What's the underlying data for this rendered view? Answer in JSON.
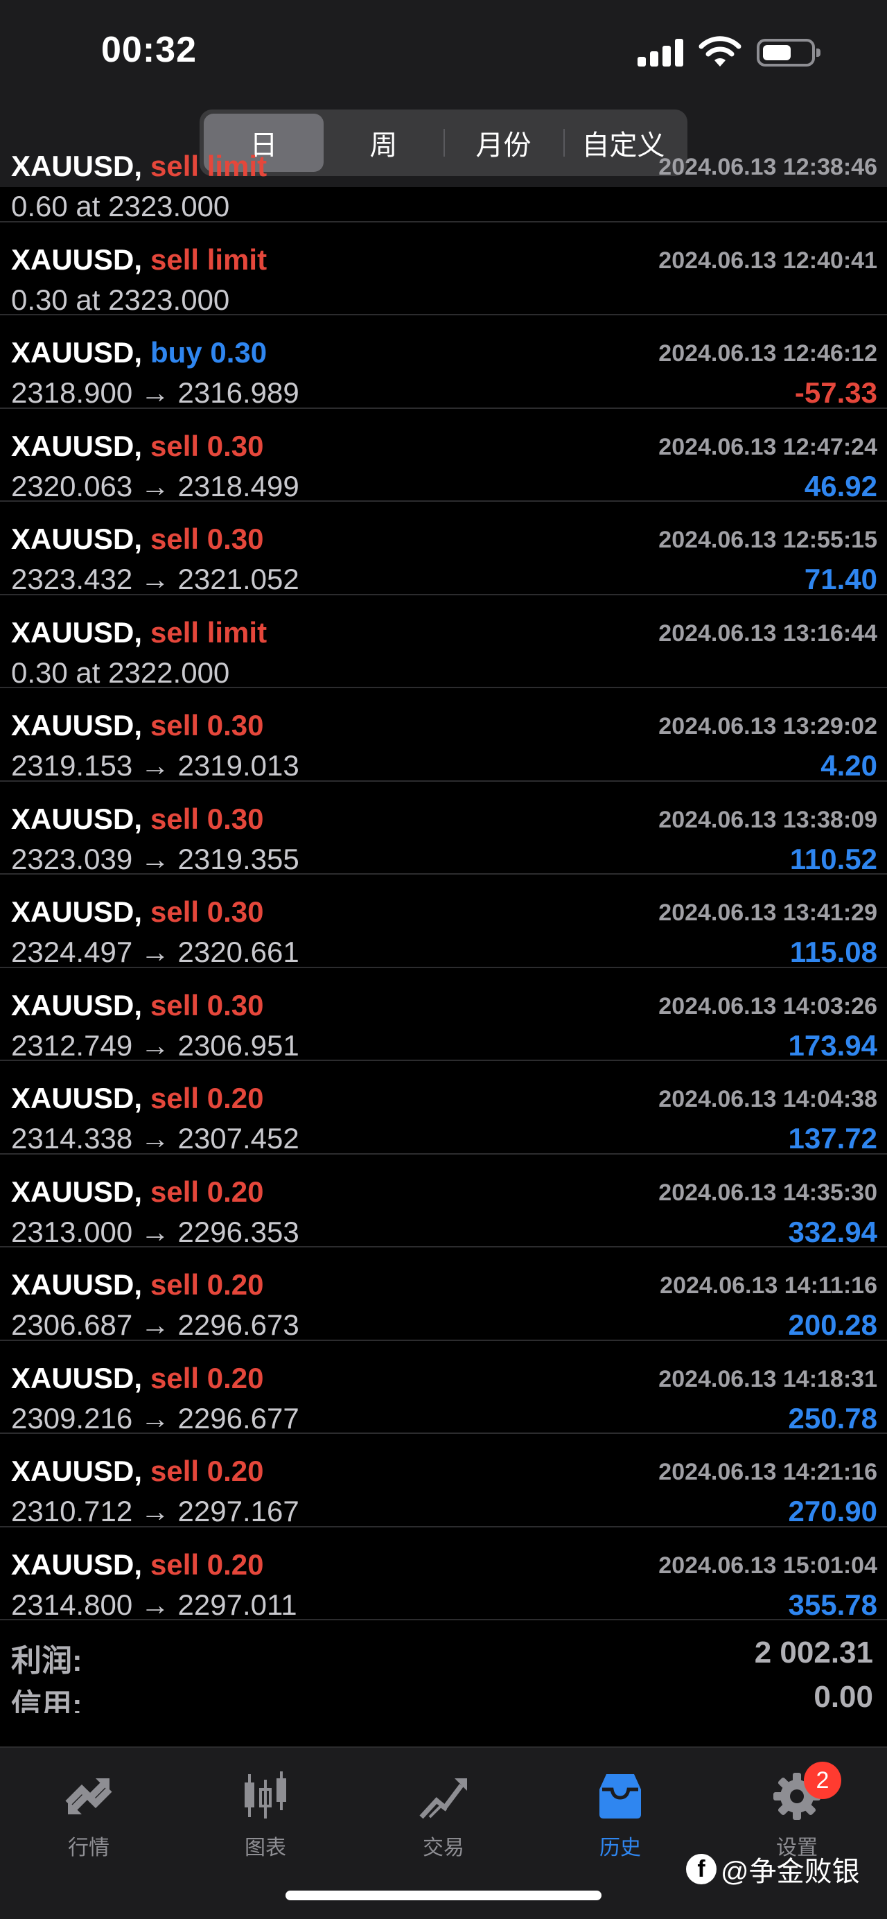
{
  "status_bar": {
    "time": "00:32"
  },
  "period_tabs": [
    {
      "label": "日",
      "active": true
    },
    {
      "label": "周",
      "active": false
    },
    {
      "label": "月份",
      "active": false
    },
    {
      "label": "自定义",
      "active": false
    }
  ],
  "orders": [
    {
      "symbol": "XAUUSD,",
      "type": "sell limit",
      "type_color": "red",
      "date": "2024.06.13 12:38:46",
      "detail": "0.60 at 2323.000",
      "profit": "",
      "profit_color": ""
    },
    {
      "symbol": "XAUUSD,",
      "type": "sell limit",
      "type_color": "red",
      "date": "2024.06.13 12:40:41",
      "detail": "0.30 at 2323.000",
      "profit": "",
      "profit_color": ""
    },
    {
      "symbol": "XAUUSD,",
      "type": "buy 0.30",
      "type_color": "blue",
      "date": "2024.06.13 12:46:12",
      "detail": "2318.900 → 2316.989",
      "profit": "-57.33",
      "profit_color": "red"
    },
    {
      "symbol": "XAUUSD,",
      "type": "sell 0.30",
      "type_color": "red",
      "date": "2024.06.13 12:47:24",
      "detail": "2320.063 → 2318.499",
      "profit": "46.92",
      "profit_color": "blue"
    },
    {
      "symbol": "XAUUSD,",
      "type": "sell 0.30",
      "type_color": "red",
      "date": "2024.06.13 12:55:15",
      "detail": "2323.432 → 2321.052",
      "profit": "71.40",
      "profit_color": "blue"
    },
    {
      "symbol": "XAUUSD,",
      "type": "sell limit",
      "type_color": "red",
      "date": "2024.06.13 13:16:44",
      "detail": "0.30 at 2322.000",
      "profit": "",
      "profit_color": ""
    },
    {
      "symbol": "XAUUSD,",
      "type": "sell 0.30",
      "type_color": "red",
      "date": "2024.06.13 13:29:02",
      "detail": "2319.153 → 2319.013",
      "profit": "4.20",
      "profit_color": "blue"
    },
    {
      "symbol": "XAUUSD,",
      "type": "sell 0.30",
      "type_color": "red",
      "date": "2024.06.13 13:38:09",
      "detail": "2323.039 → 2319.355",
      "profit": "110.52",
      "profit_color": "blue"
    },
    {
      "symbol": "XAUUSD,",
      "type": "sell 0.30",
      "type_color": "red",
      "date": "2024.06.13 13:41:29",
      "detail": "2324.497 → 2320.661",
      "profit": "115.08",
      "profit_color": "blue"
    },
    {
      "symbol": "XAUUSD,",
      "type": "sell 0.30",
      "type_color": "red",
      "date": "2024.06.13 14:03:26",
      "detail": "2312.749 → 2306.951",
      "profit": "173.94",
      "profit_color": "blue"
    },
    {
      "symbol": "XAUUSD,",
      "type": "sell 0.20",
      "type_color": "red",
      "date": "2024.06.13 14:04:38",
      "detail": "2314.338 → 2307.452",
      "profit": "137.72",
      "profit_color": "blue"
    },
    {
      "symbol": "XAUUSD,",
      "type": "sell 0.20",
      "type_color": "red",
      "date": "2024.06.13 14:35:30",
      "detail": "2313.000 → 2296.353",
      "profit": "332.94",
      "profit_color": "blue"
    },
    {
      "symbol": "XAUUSD,",
      "type": "sell 0.20",
      "type_color": "red",
      "date": "2024.06.13 14:11:16",
      "detail": "2306.687 → 2296.673",
      "profit": "200.28",
      "profit_color": "blue"
    },
    {
      "symbol": "XAUUSD,",
      "type": "sell 0.20",
      "type_color": "red",
      "date": "2024.06.13 14:18:31",
      "detail": "2309.216 → 2296.677",
      "profit": "250.78",
      "profit_color": "blue"
    },
    {
      "symbol": "XAUUSD,",
      "type": "sell 0.20",
      "type_color": "red",
      "date": "2024.06.13 14:21:16",
      "detail": "2310.712 → 2297.167",
      "profit": "270.90",
      "profit_color": "blue"
    },
    {
      "symbol": "XAUUSD,",
      "type": "sell 0.20",
      "type_color": "red",
      "date": "2024.06.13 15:01:04",
      "detail": "2314.800 → 2297.011",
      "profit": "355.78",
      "profit_color": "blue"
    }
  ],
  "summary": {
    "profit_label": "利润:",
    "profit_value": "2 002.31",
    "credit_label": "信用:",
    "credit_value": "0.00"
  },
  "tabbar": {
    "items": [
      {
        "label": "行情",
        "icon": "quotes-icon",
        "active": false
      },
      {
        "label": "图表",
        "icon": "chart-icon",
        "active": false
      },
      {
        "label": "交易",
        "icon": "trade-icon",
        "active": false
      },
      {
        "label": "历史",
        "icon": "history-icon",
        "active": true
      },
      {
        "label": "设置",
        "icon": "settings-icon",
        "active": false
      }
    ],
    "settings_badge": "2"
  },
  "watermark": "@争金败银",
  "colors": {
    "sell": "#e5473b",
    "buy": "#2f86f0",
    "loss": "#e5473b",
    "gain": "#2f86f0",
    "accent": "#2f86f0"
  }
}
